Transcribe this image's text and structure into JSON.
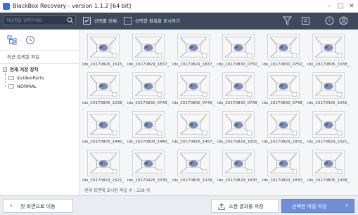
{
  "window": {
    "title": "BlackBox Recovery - version 1.1.2 [64 bit]"
  },
  "toolbar": {
    "search_placeholder": "파일명을 입력하세요",
    "select_all": "선택률 전체",
    "show_selected": "선택한 항목을 표시하기"
  },
  "sidebar": {
    "recent_label": "최근 검색된 파일",
    "tree_root": "현재 저장 장치",
    "tree_children": [
      "$VideoParts",
      "NORMAL"
    ]
  },
  "files": [
    "idx_20170826_1515_2...",
    "idx_20170829_1837_2...",
    "idx_20170829_1837_1...",
    "idx_20170830_0750_2...",
    "idx_20170830_0750_1...",
    "idx_20170805_1038_2...",
    "idx_20170805_1038_1...",
    "idx_20170830_0749_2...",
    "idx_20170830_0749_1...",
    "idx_20170830_0748_2...",
    "idx_20170830_0748_1...",
    "idx_20170425_1041_2...",
    "idx_20170805_1440_2...",
    "idx_20170805_1440_1...",
    "idx_20170826_1457_2...",
    "idx_20170829_1831_2...",
    "idx_20170829_1831_1...",
    "idx_20170829_2321_2...",
    "idx_20170829_2321_1...",
    "idx_20170425_1039_2...",
    "idx_20170805_1439_1...",
    "idx_20170829_1830_2...",
    "idx_20170829_1830_1...",
    "idx_20170805_1438_2..."
  ],
  "status": {
    "text": "현재 화면에 표시된 파일 수 : 228 개"
  },
  "bottom": {
    "back_label": "첫 화면으로 이동",
    "save_scan_label": "스캔 결과를 저장",
    "save_files_label": "선택한 파일 저장"
  },
  "colors": {
    "toolbar": "#3c4a5c",
    "primary_button": "#6f8fd8"
  }
}
